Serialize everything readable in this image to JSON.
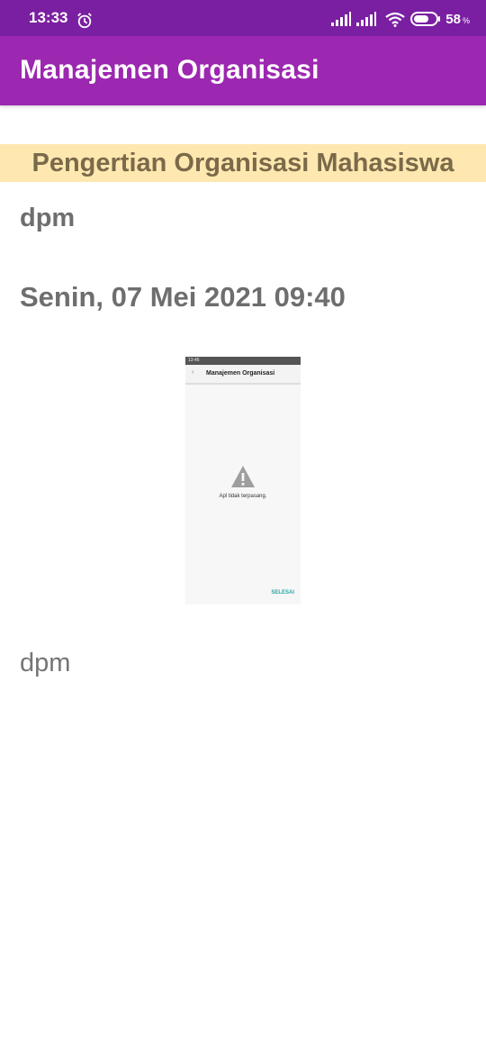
{
  "status_bar": {
    "time": "13:33",
    "battery_percent": "58",
    "battery_unit": "%",
    "icons": [
      "alarm-icon",
      "signal-icon",
      "signal-icon",
      "wifi-icon",
      "battery-icon"
    ]
  },
  "app_bar": {
    "title": "Manajemen Organisasi",
    "color": "#9c27b0"
  },
  "article": {
    "category": "Pengertian Organisasi Mahasiswa",
    "author": "dpm",
    "date": "Senin, 07 Mei 2021 09:40",
    "image": {
      "status_time": "13:46",
      "title": "Manajemen Organisasi",
      "message": "Apl tidak terpasang.",
      "action": "SELESAI"
    },
    "body": "dpm"
  },
  "colors": {
    "status_bar": "#7b1fa2",
    "banner": "#ffe8b0",
    "accent_text": "#7a6a4a"
  }
}
